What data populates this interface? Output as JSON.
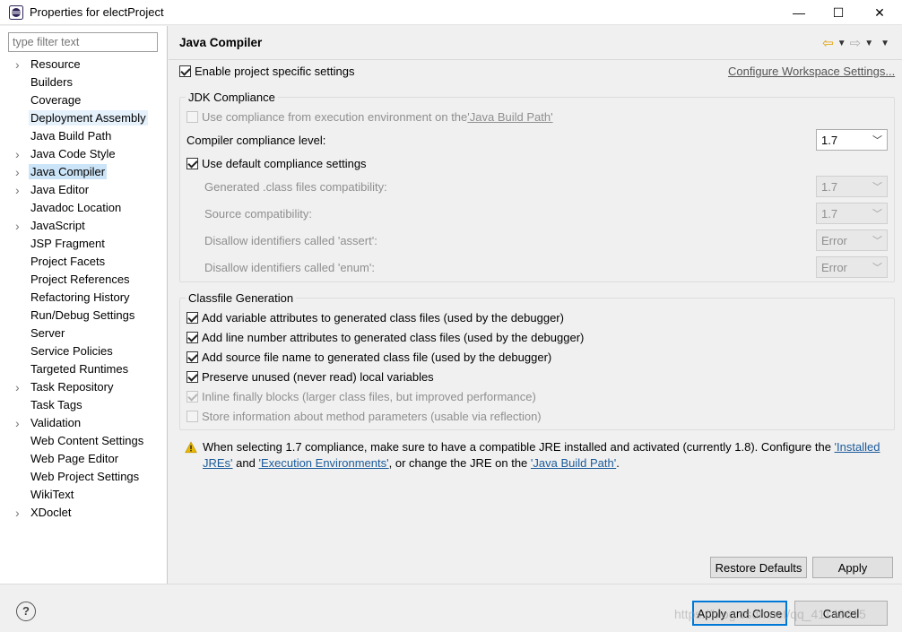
{
  "window": {
    "title": "Properties for electProject",
    "minimize_glyph": "—",
    "maximize_glyph": "☐",
    "close_glyph": "✕"
  },
  "sidebar": {
    "filter_placeholder": "type filter text",
    "items": [
      {
        "label": "Resource",
        "expandable": true
      },
      {
        "label": "Builders",
        "expandable": false
      },
      {
        "label": "Coverage",
        "expandable": false
      },
      {
        "label": "Deployment Assembly",
        "expandable": false,
        "hover": true
      },
      {
        "label": "Java Build Path",
        "expandable": false
      },
      {
        "label": "Java Code Style",
        "expandable": true
      },
      {
        "label": "Java Compiler",
        "expandable": true,
        "selected": true
      },
      {
        "label": "Java Editor",
        "expandable": true
      },
      {
        "label": "Javadoc Location",
        "expandable": false
      },
      {
        "label": "JavaScript",
        "expandable": true
      },
      {
        "label": "JSP Fragment",
        "expandable": false
      },
      {
        "label": "Project Facets",
        "expandable": false
      },
      {
        "label": "Project References",
        "expandable": false
      },
      {
        "label": "Refactoring History",
        "expandable": false
      },
      {
        "label": "Run/Debug Settings",
        "expandable": false
      },
      {
        "label": "Server",
        "expandable": false
      },
      {
        "label": "Service Policies",
        "expandable": false
      },
      {
        "label": "Targeted Runtimes",
        "expandable": false
      },
      {
        "label": "Task Repository",
        "expandable": true
      },
      {
        "label": "Task Tags",
        "expandable": false
      },
      {
        "label": "Validation",
        "expandable": true
      },
      {
        "label": "Web Content Settings",
        "expandable": false
      },
      {
        "label": "Web Page Editor",
        "expandable": false
      },
      {
        "label": "Web Project Settings",
        "expandable": false
      },
      {
        "label": "WikiText",
        "expandable": false
      },
      {
        "label": "XDoclet",
        "expandable": true
      }
    ]
  },
  "main": {
    "title": "Java Compiler",
    "enable_project_specific": {
      "label": "Enable project specific settings",
      "checked": true
    },
    "configure_workspace_link": "Configure Workspace Settings...",
    "jdk_compliance": {
      "title": "JDK Compliance",
      "use_compliance_prefix": "Use compliance from execution environment on the ",
      "use_compliance_link": "'Java Build Path'",
      "compliance_level_label": "Compiler compliance level:",
      "compliance_level_value": "1.7",
      "use_default_label": "Use default compliance settings",
      "generated_class_label": "Generated .class files compatibility:",
      "generated_class_value": "1.7",
      "source_compat_label": "Source compatibility:",
      "source_compat_value": "1.7",
      "disallow_assert_label": "Disallow identifiers called 'assert':",
      "disallow_assert_value": "Error",
      "disallow_enum_label": "Disallow identifiers called 'enum':",
      "disallow_enum_value": "Error"
    },
    "classfile_generation": {
      "title": "Classfile Generation",
      "options": [
        {
          "label": "Add variable attributes to generated class files (used by the debugger)",
          "checked": true,
          "disabled": false
        },
        {
          "label": "Add line number attributes to generated class files (used by the debugger)",
          "checked": true,
          "disabled": false
        },
        {
          "label": "Add source file name to generated class file (used by the debugger)",
          "checked": true,
          "disabled": false
        },
        {
          "label": "Preserve unused (never read) local variables",
          "checked": true,
          "disabled": false
        },
        {
          "label": "Inline finally blocks (larger class files, but improved performance)",
          "checked": true,
          "disabled": true
        },
        {
          "label": "Store information about method parameters (usable via reflection)",
          "checked": false,
          "disabled": true
        }
      ]
    },
    "warning": {
      "text_1": "When selecting 1.7 compliance, make sure to have a compatible JRE installed and activated (currently 1.8). Configure the ",
      "link_installed": "'Installed JREs'",
      "text_2": " and ",
      "link_exec_env": "'Execution Environments'",
      "text_3": ", or change the JRE on the ",
      "link_build_path": "'Java Build Path'",
      "text_4": "."
    },
    "restore_defaults": "Restore Defaults",
    "apply": "Apply"
  },
  "footer": {
    "help": "?",
    "apply_and_close": "Apply and Close",
    "cancel": "Cancel",
    "watermark": "https://blog.csdn.net/qq_41143615"
  },
  "colors": {
    "accent": "#0078d7",
    "link": "#1a5a9a",
    "selection": "#cce4f7",
    "warning": "#e8b800"
  }
}
